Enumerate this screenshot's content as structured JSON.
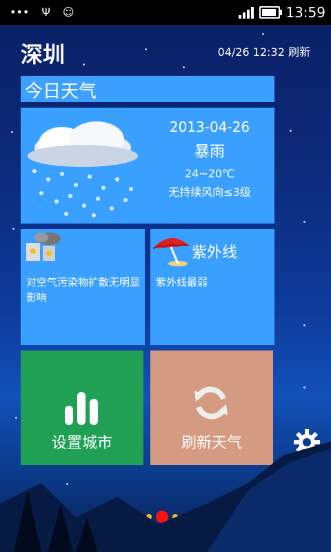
{
  "status_bar": {
    "time": "13:59",
    "icons": [
      "dots-icon",
      "usb-icon",
      "debug-icon",
      "signal-icon",
      "battery-icon"
    ]
  },
  "header": {
    "city": "深圳",
    "refresh_time": "04/26 12:32 刷新"
  },
  "today": {
    "title": "今日天气",
    "date": "2013-04-26",
    "condition": "暴雨",
    "temp": "24~20℃",
    "wind": "无持续风向≤3级",
    "icon": "rain-cloud-icon"
  },
  "air": {
    "text": "对空气污染物扩散无明显影响",
    "icon": "factory-icon"
  },
  "uv": {
    "title": "紫外线",
    "text": "紫外线最弱",
    "icon": "umbrella-icon"
  },
  "actions": {
    "set_city": "设置城市",
    "refresh": "刷新天气"
  },
  "side": {
    "settings_icon": "gear-icon",
    "exit_icon": "exit-icon"
  },
  "pager": {
    "pages": 3,
    "active": 2
  },
  "colors": {
    "tile_blue": "#3aa0ff",
    "green": "#1fa055",
    "peach": "#d59a82",
    "dot_yellow": "#f2c020",
    "dot_red": "#ff1010"
  }
}
